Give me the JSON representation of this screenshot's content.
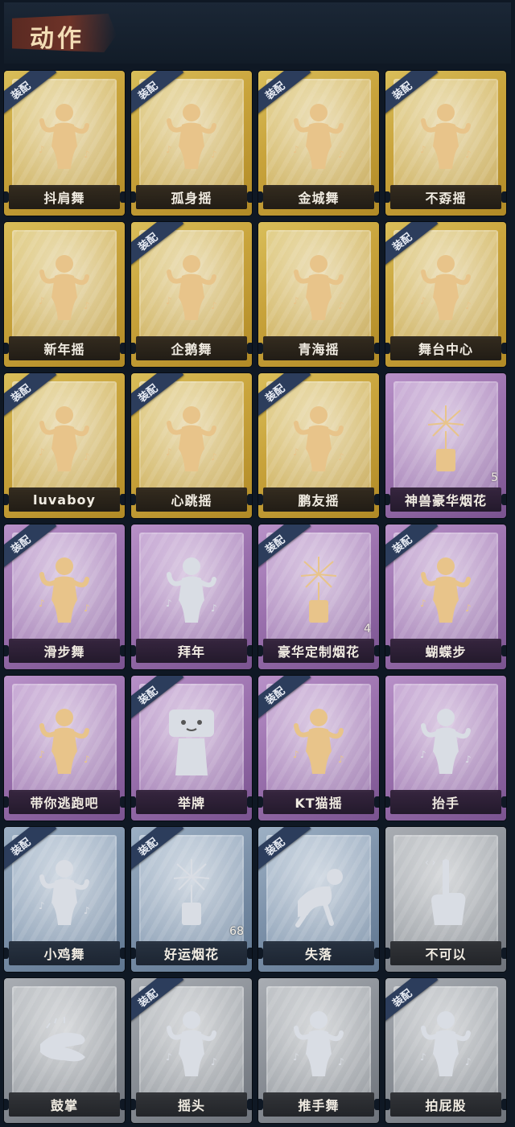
{
  "header": {
    "title": "动作"
  },
  "colors": {
    "gold": "#c9a43c",
    "purple": "#9a70ad",
    "blue": "#7d92aa",
    "grey": "#8b9097",
    "badge": "#2c3d5c",
    "figure_gold": "#e8c48a",
    "figure_silver": "#d9dde4"
  },
  "badge_label": "装配",
  "cards": [
    {
      "label": "抖肩舞",
      "tier": "gold",
      "equipped": true,
      "icon": "dancer-icon"
    },
    {
      "label": "孤身摇",
      "tier": "gold",
      "equipped": true,
      "icon": "dancer-icon"
    },
    {
      "label": "金城舞",
      "tier": "gold",
      "equipped": true,
      "icon": "dancer-icon"
    },
    {
      "label": "不孬摇",
      "tier": "gold",
      "equipped": true,
      "icon": "dancer-icon"
    },
    {
      "label": "新年摇",
      "tier": "gold",
      "equipped": false,
      "icon": "dancer-icon"
    },
    {
      "label": "企鹅舞",
      "tier": "gold",
      "equipped": true,
      "icon": "dancer-icon"
    },
    {
      "label": "青海摇",
      "tier": "gold",
      "equipped": false,
      "icon": "dancer-icon"
    },
    {
      "label": "舞台中心",
      "tier": "gold",
      "equipped": true,
      "icon": "dancer-icon"
    },
    {
      "label": "luvaboy",
      "tier": "gold",
      "equipped": true,
      "icon": "dancer-icon"
    },
    {
      "label": "心跳摇",
      "tier": "gold",
      "equipped": true,
      "icon": "dancer-icon"
    },
    {
      "label": "鹏友摇",
      "tier": "gold",
      "equipped": true,
      "icon": "dancer-icon"
    },
    {
      "label": "神兽豪华烟花",
      "tier": "purple",
      "equipped": false,
      "icon": "firework-icon",
      "count": "5"
    },
    {
      "label": "滑步舞",
      "tier": "purple",
      "equipped": true,
      "icon": "dancer-icon"
    },
    {
      "label": "拜年",
      "tier": "purple",
      "equipped": false,
      "icon": "dancer-icon",
      "silver": true
    },
    {
      "label": "豪华定制烟花",
      "tier": "purple",
      "equipped": true,
      "icon": "firework-icon",
      "count": "4"
    },
    {
      "label": "蝴蝶步",
      "tier": "purple",
      "equipped": true,
      "icon": "dancer-icon"
    },
    {
      "label": "带你逃跑吧",
      "tier": "purple",
      "equipped": false,
      "icon": "dancer-icon"
    },
    {
      "label": "举牌",
      "tier": "purple",
      "equipped": true,
      "icon": "sign-icon",
      "silver": true
    },
    {
      "label": "KT猫摇",
      "tier": "purple",
      "equipped": true,
      "icon": "dancer-icon"
    },
    {
      "label": "抬手",
      "tier": "purple",
      "equipped": false,
      "icon": "dancer-icon",
      "silver": true
    },
    {
      "label": "小鸡舞",
      "tier": "blue",
      "equipped": true,
      "icon": "dancer-icon",
      "silver": true
    },
    {
      "label": "好运烟花",
      "tier": "blue",
      "equipped": true,
      "icon": "firework-icon",
      "silver": true,
      "count": "68"
    },
    {
      "label": "失落",
      "tier": "blue",
      "equipped": true,
      "icon": "crawl-icon",
      "silver": true
    },
    {
      "label": "不可以",
      "tier": "grey",
      "equipped": false,
      "icon": "finger-icon",
      "silver": true
    },
    {
      "label": "鼓掌",
      "tier": "grey",
      "equipped": false,
      "icon": "clap-icon",
      "silver": true
    },
    {
      "label": "摇头",
      "tier": "grey",
      "equipped": true,
      "icon": "dancer-icon",
      "silver": true
    },
    {
      "label": "推手舞",
      "tier": "grey",
      "equipped": false,
      "icon": "dancer-icon",
      "silver": true
    },
    {
      "label": "拍屁股",
      "tier": "grey",
      "equipped": true,
      "icon": "dancer-icon",
      "silver": true
    }
  ]
}
